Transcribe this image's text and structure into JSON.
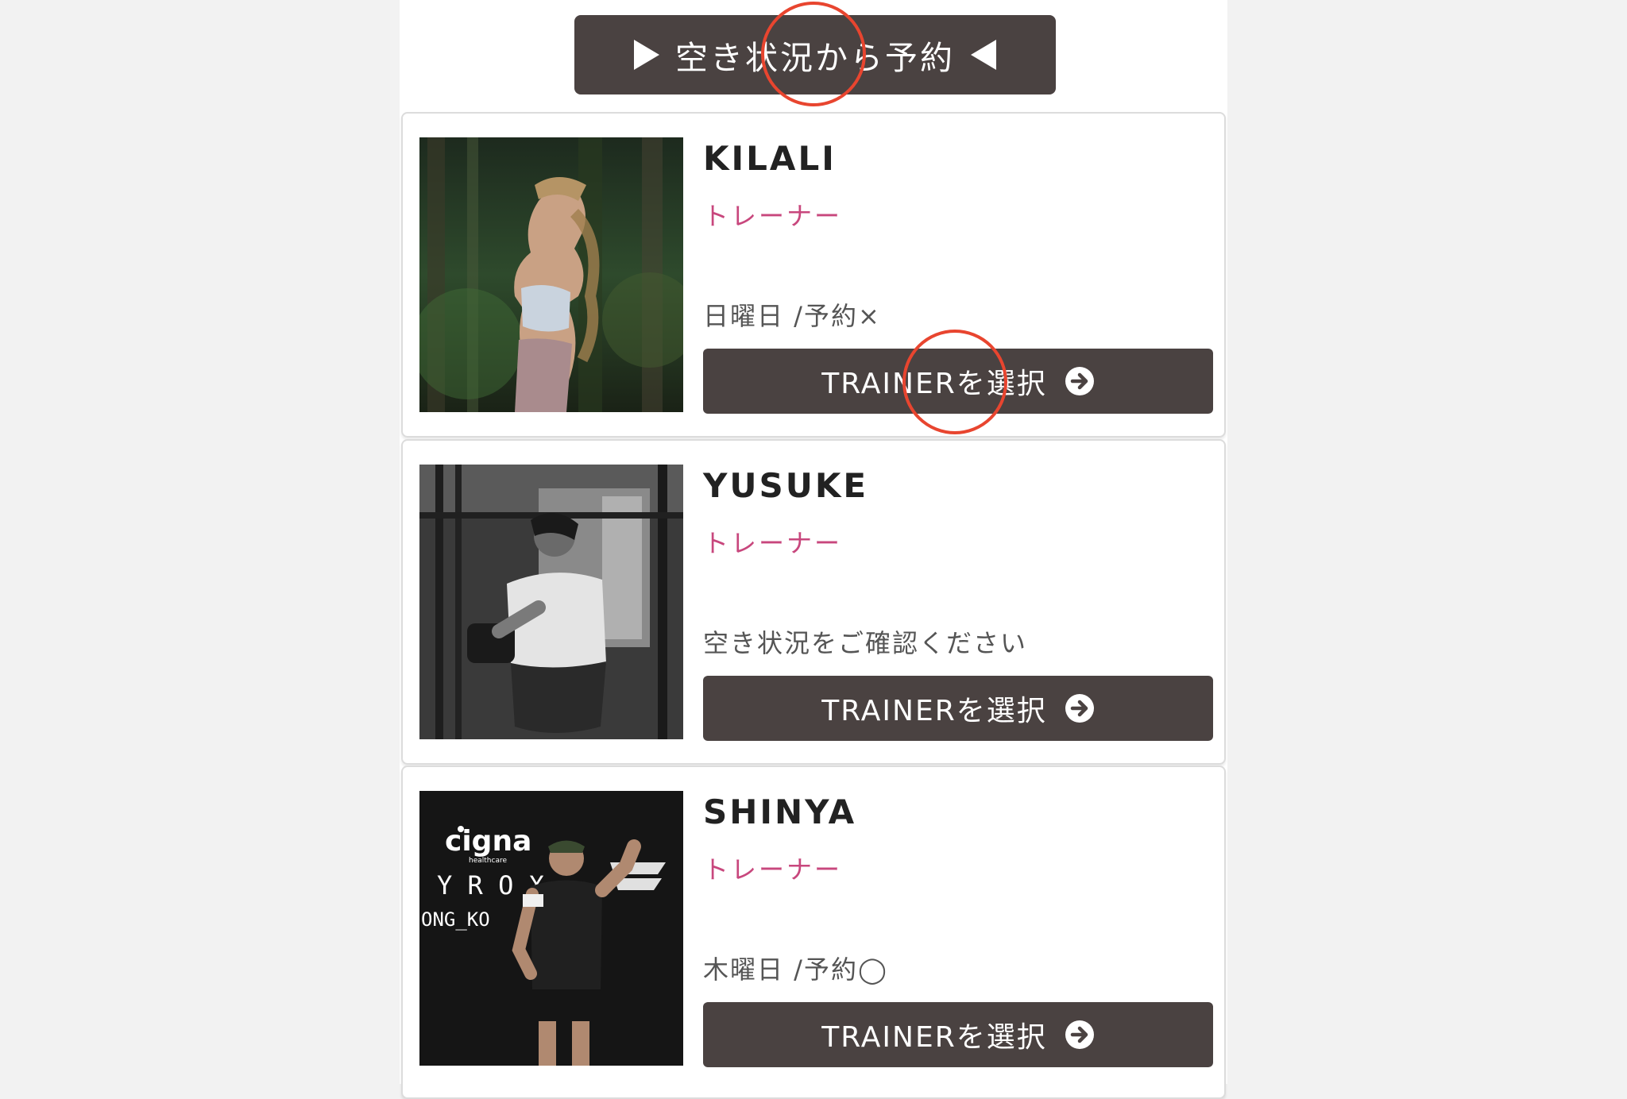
{
  "availability_button": {
    "label": "空き状況から予約"
  },
  "trainers": [
    {
      "name": "KILALI",
      "role": "トレーナー",
      "status": "日曜日 /予約×",
      "button_label": "TRAINERを選択"
    },
    {
      "name": "YUSUKE",
      "role": "トレーナー",
      "status": "空き状況をご確認ください",
      "button_label": "TRAINERを選択"
    },
    {
      "name": "SHINYA",
      "role": "トレーナー",
      "status": "木曜日 /予約◯",
      "button_label": "TRAINERを選択",
      "photo_text": {
        "brand": "cigna",
        "brand_sub": "healthcare",
        "line1": "Y R O X",
        "line2": "ONG_KO"
      }
    }
  ],
  "colors": {
    "button_bg": "#4a4241",
    "role_text": "#c8477d",
    "annotation": "#e8452f"
  },
  "icons": {
    "select_arrow": "arrow-right-circle-icon",
    "left_triangle": "triangle-right-icon",
    "right_triangle": "triangle-left-icon"
  }
}
